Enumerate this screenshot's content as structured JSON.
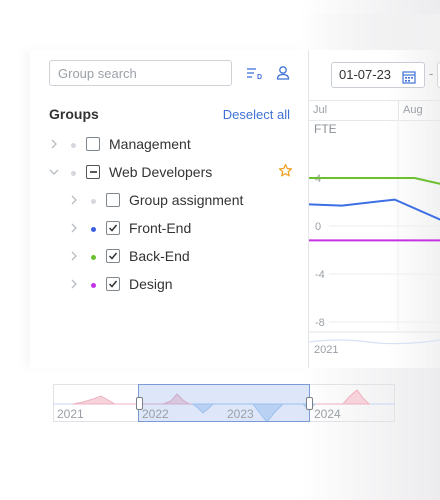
{
  "sidebar": {
    "search": {
      "placeholder": "Group search",
      "value": ""
    },
    "sort_icon": "sort-descending-icon",
    "person_icon": "person-icon",
    "groups_title": "Groups",
    "deselect_all": "Deselect all",
    "groups": [
      {
        "label": "Management",
        "checked": "unchecked",
        "dot_color": "#d4d7db",
        "expanded": false,
        "level": 0
      },
      {
        "label": "Web Developers",
        "checked": "partial",
        "dot_color": "#d4d7db",
        "expanded": true,
        "level": 0,
        "favorite": true
      },
      {
        "label": "Group assignment",
        "checked": "unchecked",
        "dot_color": "#d4d7db",
        "expanded": false,
        "level": 1
      },
      {
        "label": "Front-End",
        "checked": "checked",
        "dot_color": "#3b5fe0",
        "expanded": false,
        "level": 1
      },
      {
        "label": "Back-End",
        "checked": "checked",
        "dot_color": "#6cbf2e",
        "expanded": false,
        "level": 1
      },
      {
        "label": "Design",
        "checked": "checked",
        "dot_color": "#c233e6",
        "expanded": false,
        "level": 1
      }
    ]
  },
  "chart": {
    "date_from": "01-07-23",
    "calendar_icon": "calendar-icon",
    "date_separator": "-",
    "months": [
      "Jul",
      "Aug"
    ],
    "unit": "FTE",
    "y_ticks": [
      "4",
      "0",
      "-4",
      "-8"
    ],
    "mini_year": "2021",
    "colors": {
      "front_end": "#3b6fe3",
      "back_end": "#6cbf2e",
      "design": "#c233e6"
    }
  },
  "chart_data": {
    "type": "line",
    "categories": [
      "Jul",
      "Aug"
    ],
    "ylabel": "FTE",
    "yticks": [
      4,
      0,
      -4,
      -8
    ],
    "series": [
      {
        "name": "Back-End",
        "points": [
          [
            0,
            4
          ],
          [
            0.55,
            4
          ],
          [
            0.8,
            4
          ],
          [
            1,
            3.5
          ]
        ]
      },
      {
        "name": "Front-End",
        "points": [
          [
            0,
            1.8
          ],
          [
            0.25,
            1.7
          ],
          [
            0.65,
            2.2
          ],
          [
            1,
            0.5
          ]
        ]
      },
      {
        "name": "Design",
        "points": [
          [
            0,
            -1.2
          ],
          [
            1,
            -1.2
          ]
        ]
      }
    ]
  },
  "navigator": {
    "years": [
      "2021",
      "2022",
      "2023",
      "2024"
    ],
    "selection_start": 0.25,
    "selection_end": 0.75
  }
}
